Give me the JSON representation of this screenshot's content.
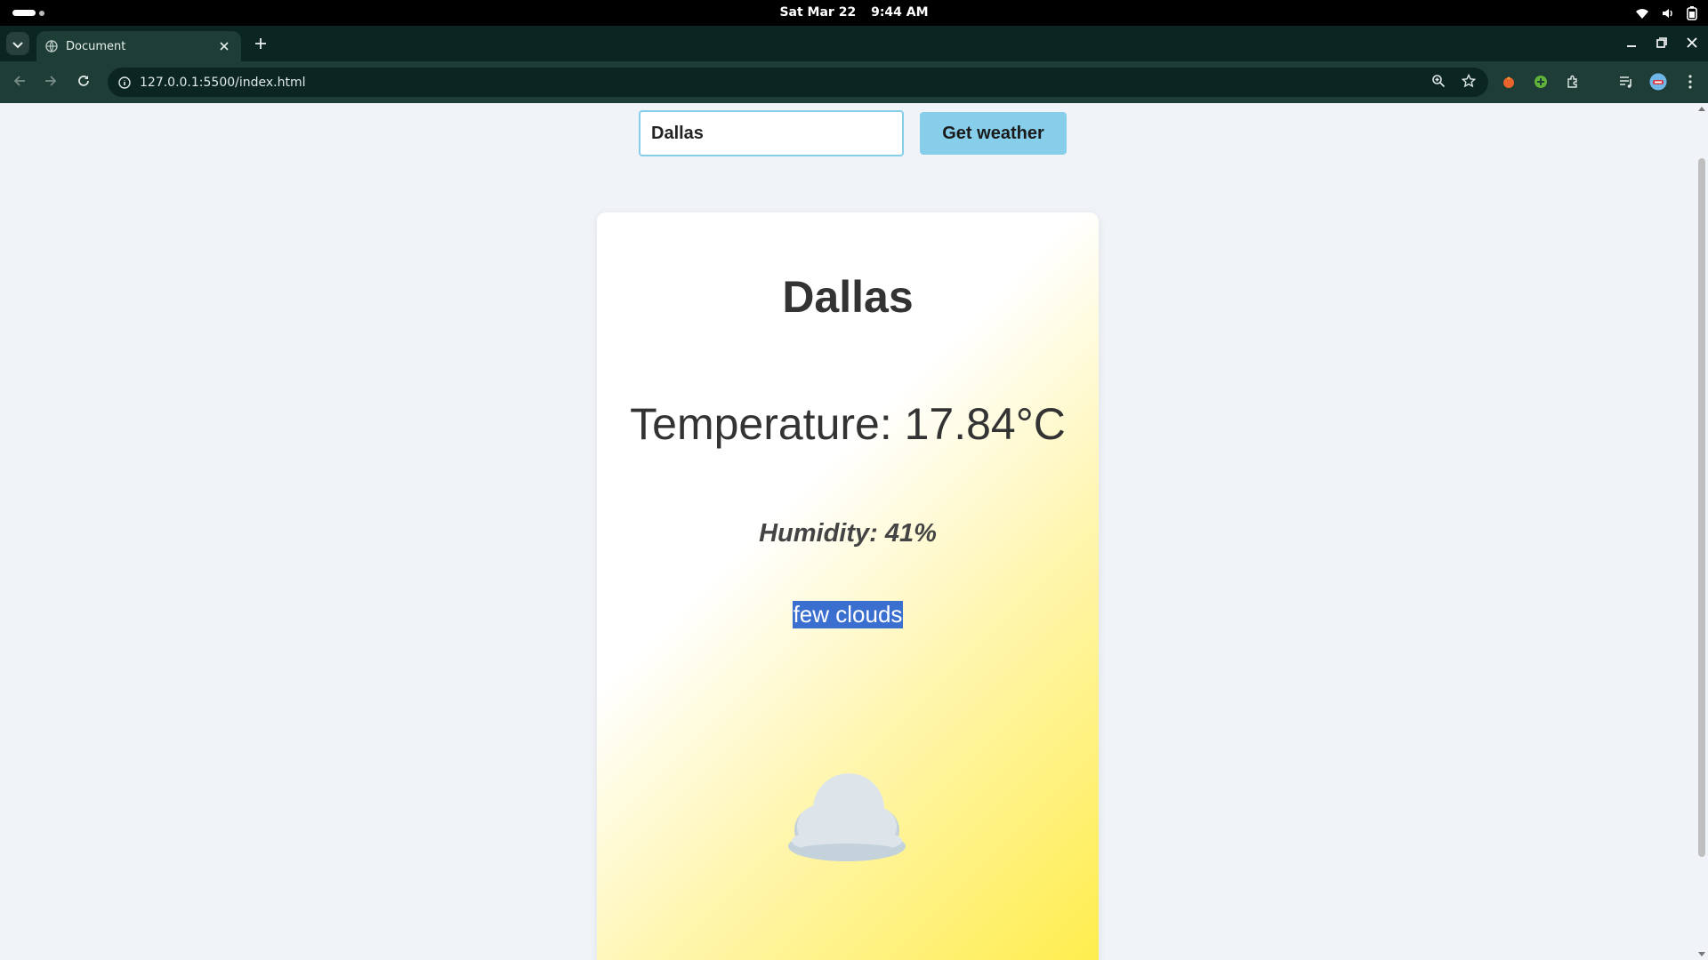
{
  "os": {
    "date": "Sat Mar 22",
    "time": "9:44 AM"
  },
  "browser": {
    "tab_title": "Document",
    "url": "127.0.0.1:5500/index.html"
  },
  "page": {
    "search": {
      "value": "Dallas",
      "button_label": "Get weather"
    },
    "card": {
      "city": "Dallas",
      "temperature": "Temperature: 17.84°C",
      "humidity": "Humidity: 41%",
      "description": "few clouds",
      "icon": "cloud-emoji"
    }
  },
  "colors": {
    "accent": "#87ceeb",
    "selection": "#3b6fcf",
    "card_gradient_end": "#ffed4a"
  }
}
